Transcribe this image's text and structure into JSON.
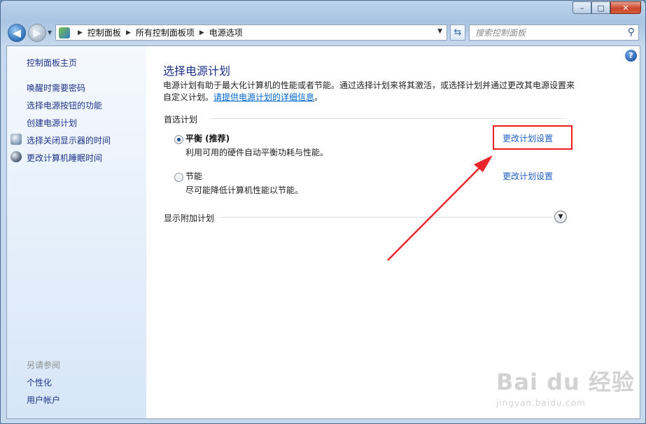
{
  "window": {
    "caption_buttons": {
      "minimize": "–",
      "maximize": "□",
      "close": "✕"
    }
  },
  "nav": {
    "breadcrumb": [
      "控制面板",
      "所有控制面板项",
      "电源选项"
    ],
    "search_placeholder": "搜索控制面板"
  },
  "sidebar": {
    "home_link": "控制面板主页",
    "links": [
      "唤醒时需要密码",
      "选择电源按钮的功能",
      "创建电源计划",
      "选择关闭显示器的时间",
      "更改计算机睡眠时间"
    ],
    "see_also_label": "另请参阅",
    "see_also_links": [
      "个性化",
      "用户帐户"
    ]
  },
  "main": {
    "title": "选择电源计划",
    "description": "电源计划有助于最大化计算机的性能或者节能。通过选择计划来将其激活，或选择计划并通过更改其电源设置来自定义计划。",
    "description_link": "请提供电源计划的详细信息",
    "preferred_plans_label": "首选计划",
    "plans": [
      {
        "name": "平衡 (推荐)",
        "description": "利用可用的硬件自动平衡功耗与性能。",
        "selected": true,
        "change_link": "更改计划设置"
      },
      {
        "name": "节能",
        "description": "尽可能降低计算机性能以节能。",
        "selected": false,
        "change_link": "更改计划设置"
      }
    ],
    "additional_plans_label": "显示附加计划"
  },
  "annotation": {
    "highlight_color": "#ee1c1c"
  },
  "watermark": {
    "logo": "Bai du 经验",
    "url": "jingyan.baidu.com"
  }
}
